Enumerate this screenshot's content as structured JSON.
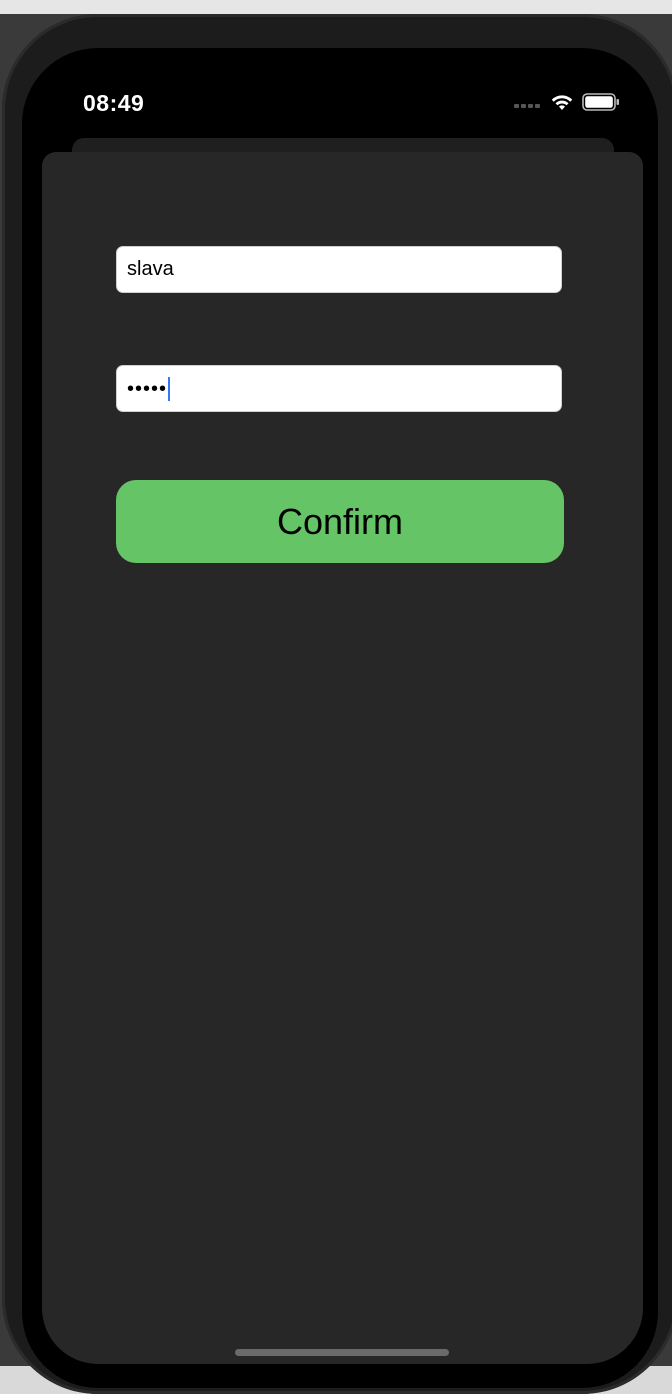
{
  "status_bar": {
    "time": "08:49",
    "icons": [
      "signal-dots-icon",
      "wifi-icon",
      "battery-icon"
    ]
  },
  "login_form": {
    "username_value": "slava",
    "password_masked": "•••••",
    "confirm_label": "Confirm"
  },
  "colors": {
    "sheet_background": "#272727",
    "confirm_button": "#65c466",
    "caret": "#3478f6"
  }
}
